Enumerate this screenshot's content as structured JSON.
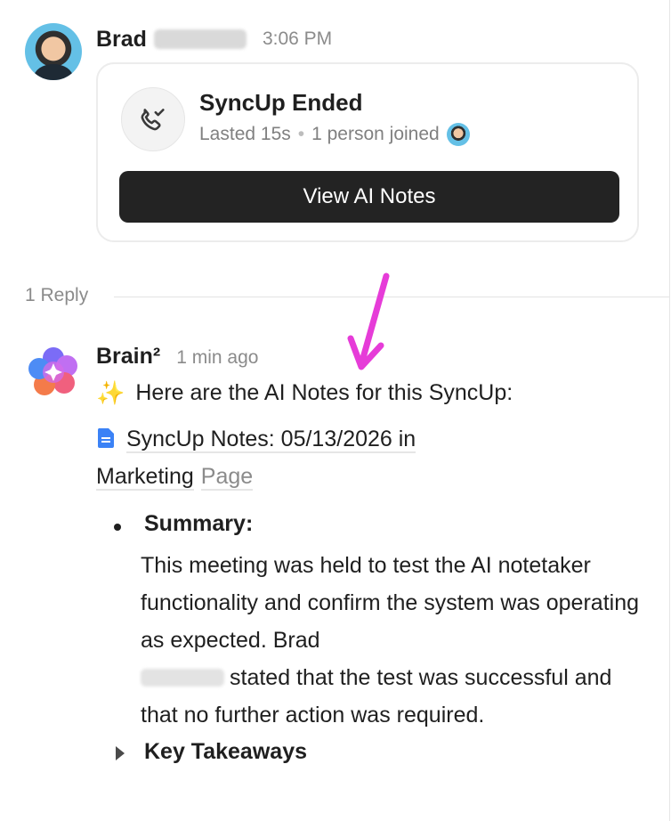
{
  "message": {
    "author": "Brad",
    "time": "3:06 PM",
    "card": {
      "title": "SyncUp Ended",
      "duration": "Lasted 15s",
      "separator": "•",
      "participants": "1 person joined",
      "button_label": "View AI Notes"
    }
  },
  "thread": {
    "reply_count_label": "1 Reply"
  },
  "reply": {
    "author": "Brain²",
    "time": "1 min ago",
    "intro_emoji": "✨",
    "intro_text": "Here are the AI Notes for this SyncUp:",
    "doc_link_text": "SyncUp Notes: 05/13/2026 in Marketing",
    "doc_kind": "Page",
    "summary_title": "Summary:",
    "summary_line1": "This meeting was held to test the AI notetaker functionality and confirm the system was operating as expected. Brad",
    "summary_line2": "stated that the test was successful and that no further action was required.",
    "takeaways_title": "Key Takeaways"
  },
  "colors": {
    "accent_arrow": "#e63cd8",
    "button_bg": "#232323",
    "doc_icon": "#3b82f6"
  }
}
